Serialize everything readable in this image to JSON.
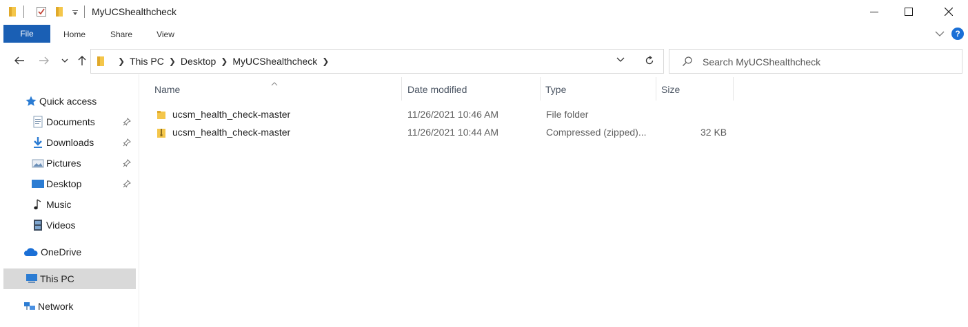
{
  "window": {
    "title": "MyUCShealthcheck"
  },
  "ribbon": {
    "tabs": [
      {
        "label": "File"
      },
      {
        "label": "Home"
      },
      {
        "label": "Share"
      },
      {
        "label": "View"
      }
    ],
    "help_label": "?"
  },
  "address": {
    "path": [
      "This PC",
      "Desktop",
      "MyUCShealthcheck"
    ]
  },
  "search": {
    "placeholder": "Search MyUCShealthcheck"
  },
  "sidebar": {
    "items": [
      {
        "label": "Quick access",
        "icon": "star-icon"
      },
      {
        "label": "Documents",
        "icon": "documents-icon",
        "pinned": true
      },
      {
        "label": "Downloads",
        "icon": "downloads-icon",
        "pinned": true
      },
      {
        "label": "Pictures",
        "icon": "pictures-icon",
        "pinned": true
      },
      {
        "label": "Desktop",
        "icon": "desktop-icon",
        "pinned": true
      },
      {
        "label": "Music",
        "icon": "music-icon"
      },
      {
        "label": "Videos",
        "icon": "videos-icon"
      },
      {
        "label": "OneDrive",
        "icon": "onedrive-icon"
      },
      {
        "label": "This PC",
        "icon": "this-pc-icon",
        "selected": true
      },
      {
        "label": "Network",
        "icon": "network-icon"
      }
    ]
  },
  "file_list": {
    "columns": [
      "Name",
      "Date modified",
      "Type",
      "Size"
    ],
    "rows": [
      {
        "name": "ucsm_health_check-master",
        "date": "11/26/2021 10:46 AM",
        "type": "File folder",
        "size": "",
        "icon": "folder-icon"
      },
      {
        "name": "ucsm_health_check-master",
        "date": "11/26/2021 10:44 AM",
        "type": "Compressed (zipped)...",
        "size": "32 KB",
        "icon": "zip-folder-icon"
      }
    ]
  },
  "colors": {
    "accent": "#1a5fb4",
    "folder": "#f4c64a",
    "selected_bg": "#d9d9d9"
  }
}
